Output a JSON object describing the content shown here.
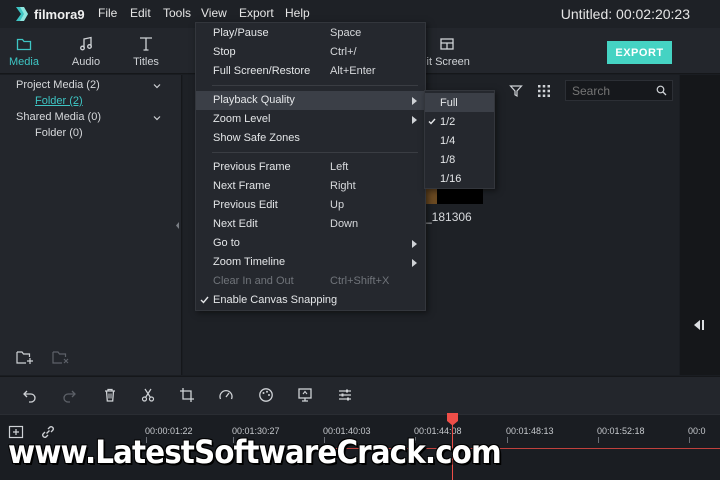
{
  "app": {
    "logo_text": "filmora9",
    "project_status": "Untitled: 00:02:20:23"
  },
  "menubar": {
    "items": [
      "File",
      "Edit",
      "Tools",
      "View",
      "Export",
      "Help"
    ]
  },
  "tabs": [
    {
      "label": "Media",
      "icon": "folder-icon",
      "active": true
    },
    {
      "label": "Audio",
      "icon": "music-note-icon",
      "active": false
    },
    {
      "label": "Titles",
      "icon": "text-icon",
      "active": false
    }
  ],
  "split_screen_tab": {
    "label": "lit Screen",
    "icon": "split-screen-icon"
  },
  "export_button": {
    "label": "EXPORT"
  },
  "media_tree": {
    "project_media": "Project Media (2)",
    "project_folder": "Folder (2)",
    "shared_media": "Shared Media (0)",
    "shared_folder": "Folder (0)"
  },
  "search": {
    "placeholder": "Search"
  },
  "media_item": {
    "label": "_181306"
  },
  "view_menu": {
    "items": [
      {
        "label": "Play/Pause",
        "shortcut": "Space"
      },
      {
        "label": "Stop",
        "shortcut": "Ctrl+/"
      },
      {
        "label": "Full Screen/Restore",
        "shortcut": "Alt+Enter"
      },
      {
        "label": "Playback Quality",
        "submenu": true,
        "highlighted": true
      },
      {
        "label": "Zoom Level",
        "submenu": true
      },
      {
        "label": "Show Safe Zones"
      },
      {
        "label": "Previous Frame",
        "shortcut": "Left"
      },
      {
        "label": "Next Frame",
        "shortcut": "Right"
      },
      {
        "label": "Previous Edit",
        "shortcut": "Up"
      },
      {
        "label": "Next Edit",
        "shortcut": "Down"
      },
      {
        "label": "Go to",
        "submenu": true
      },
      {
        "label": "Zoom Timeline",
        "submenu": true
      },
      {
        "label": "Clear In and Out",
        "shortcut": "Ctrl+Shift+X",
        "disabled": true
      },
      {
        "label": "Enable Canvas Snapping",
        "checked": true
      }
    ]
  },
  "playback_quality_submenu": {
    "items": [
      {
        "label": "Full",
        "highlighted": true
      },
      {
        "label": "1/2",
        "checked": true
      },
      {
        "label": "1/4"
      },
      {
        "label": "1/8"
      },
      {
        "label": "1/16"
      }
    ]
  },
  "timeline": {
    "ruler_labels": [
      "00:00:01:22",
      "00:01:30:27",
      "00:01:40:03",
      "00:01:44:08",
      "00:01:48:13",
      "00:01:52:18",
      "00:0"
    ]
  },
  "watermark": {
    "text": "www.LatestSoftwareCrack.com"
  },
  "colors": {
    "accent": "#3ec5c4",
    "export_button": "#45d3c3",
    "playhead": "#ee4e48"
  }
}
